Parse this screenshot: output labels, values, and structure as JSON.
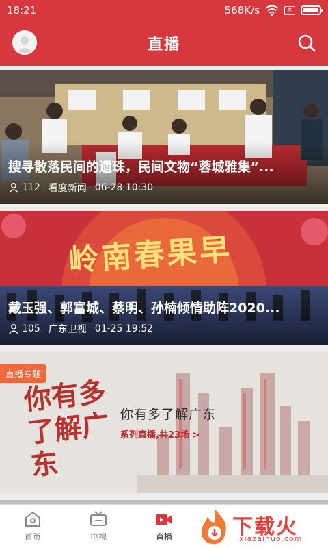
{
  "status_bar": {
    "time": "18:21",
    "speed": "568K/s",
    "sim_label": "✕"
  },
  "header": {
    "title": "直播"
  },
  "feed": [
    {
      "title": "搜寻散落民间的遗珠，民间文物“蓉城雅集”...",
      "viewers": "112",
      "source": "看度新闻",
      "time": "06-28 10:30"
    },
    {
      "title": "戴玉强、郭富城、蔡明、孙楠倾情助阵2020...",
      "viewers": "105",
      "source": "广东卫视",
      "time": "01-25 19:52",
      "banner_text": "岭南春果早"
    },
    {
      "badge": "直播专题",
      "title": "你有多了解广东",
      "subtitle": "系列直播,共23场 >",
      "calligraphy": "你有多了解广东"
    }
  ],
  "tabs": [
    {
      "label": "首页",
      "icon": "home-icon"
    },
    {
      "label": "电视",
      "icon": "tv-icon"
    },
    {
      "label": "直播",
      "icon": "live-video-icon",
      "active": true
    }
  ],
  "watermark": {
    "text": "下载火",
    "url": "xiazaihuo.com"
  },
  "colors": {
    "brand_red": "#d7383d",
    "badge_orange": "#f0683c"
  }
}
